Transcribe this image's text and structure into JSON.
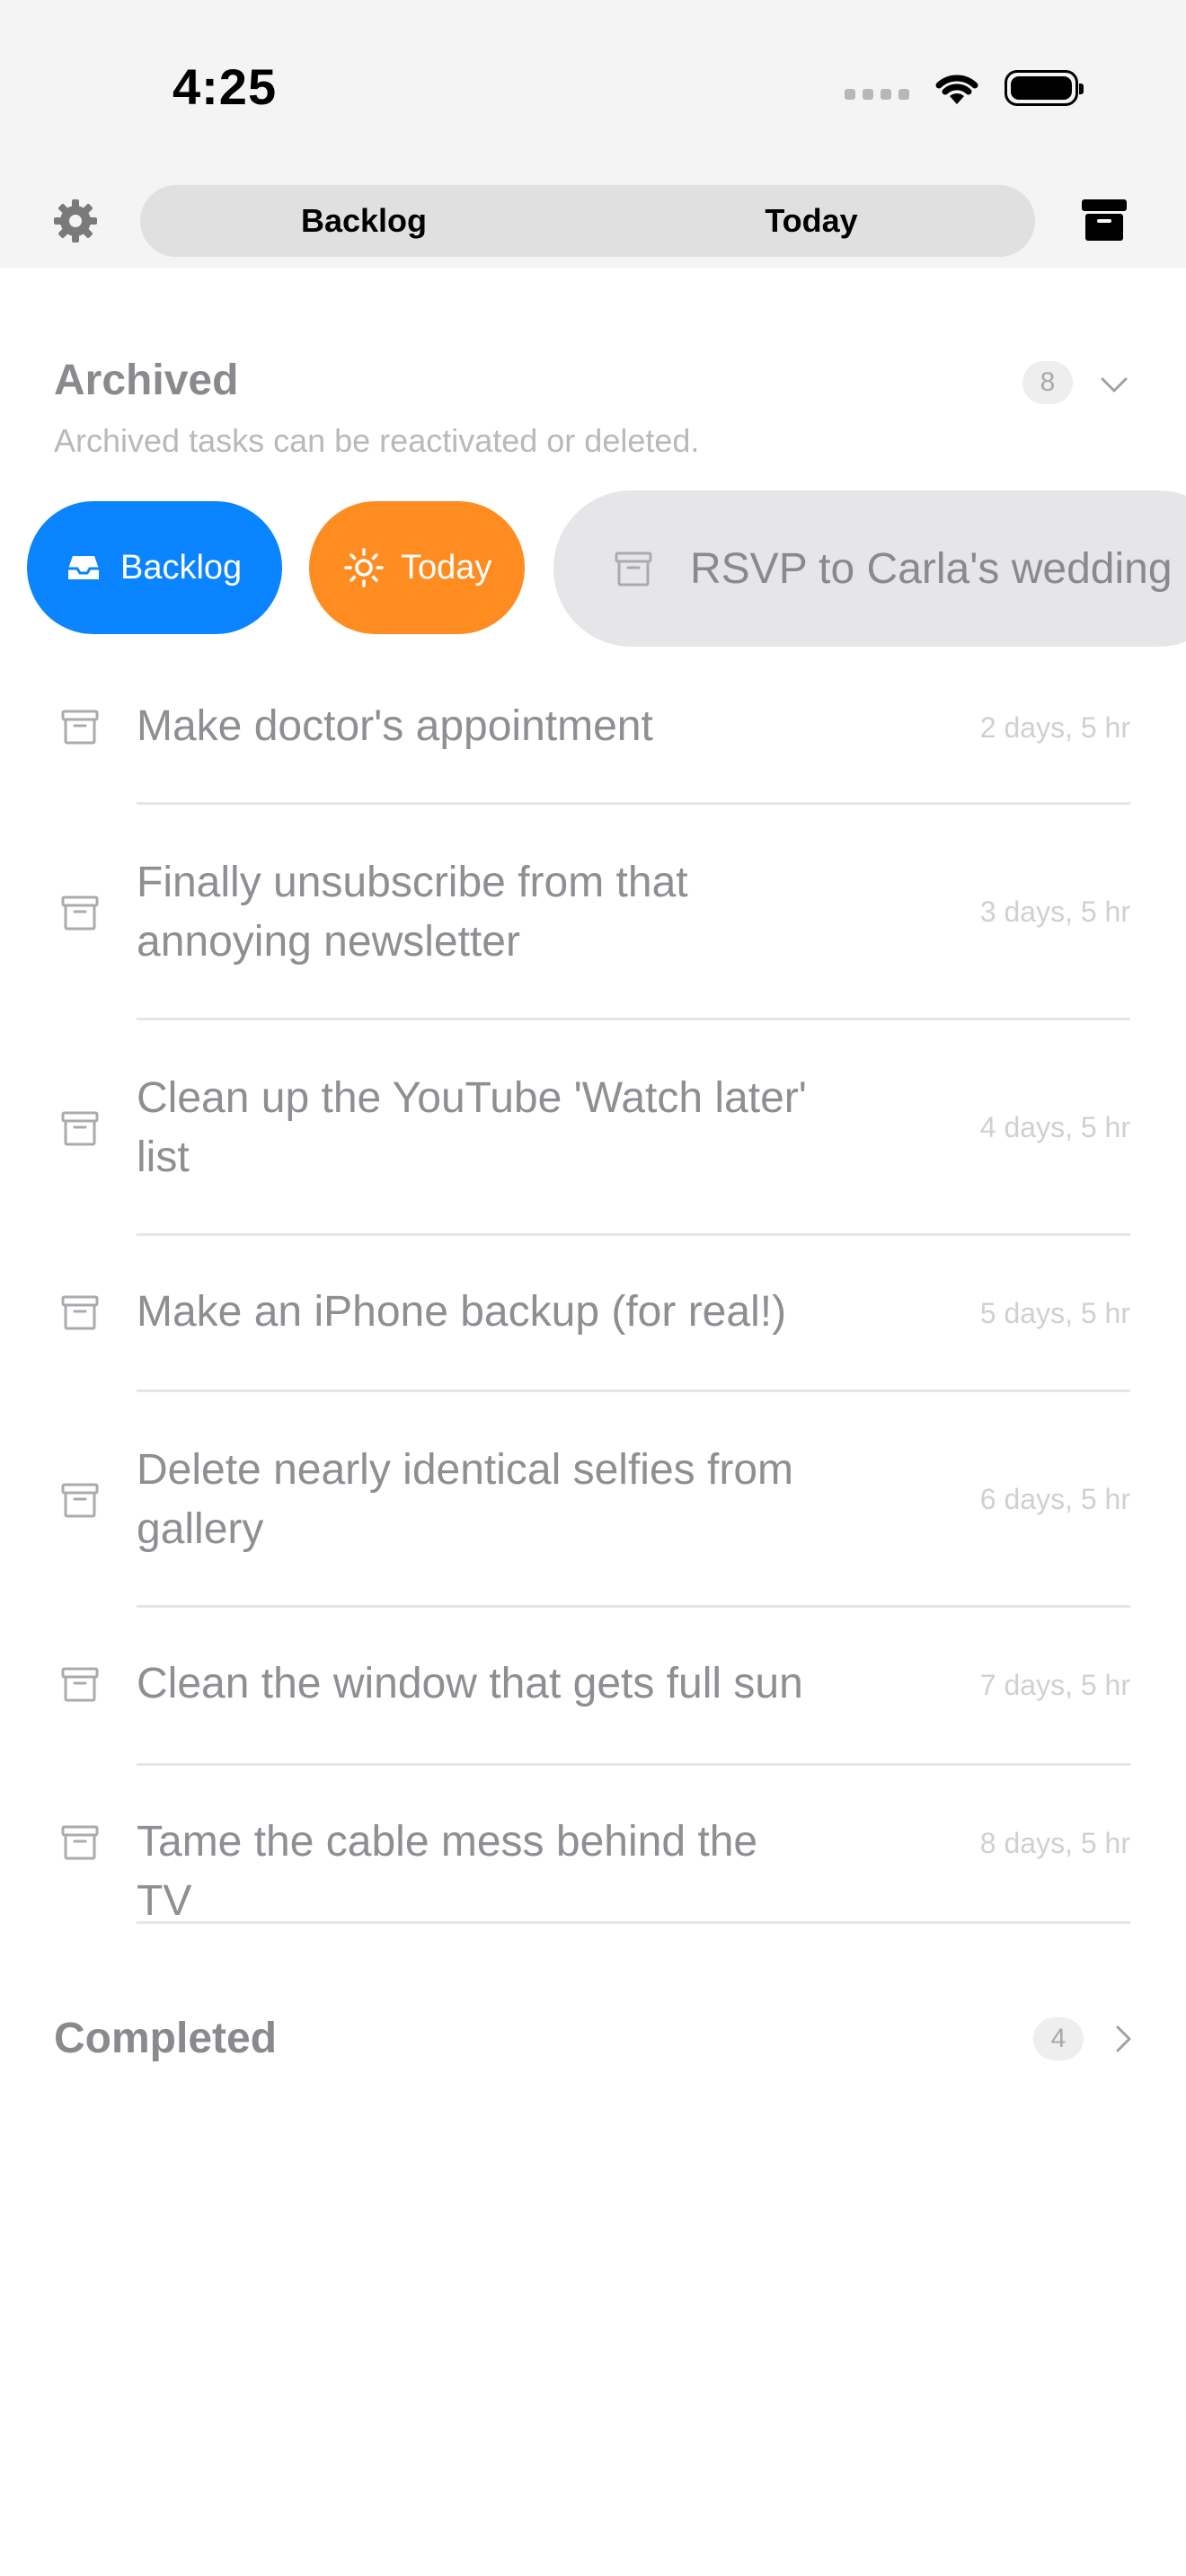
{
  "status_bar": {
    "time": "4:25"
  },
  "nav": {
    "segments": [
      {
        "label": "Backlog"
      },
      {
        "label": "Today"
      }
    ]
  },
  "archived": {
    "title": "Archived",
    "subtitle": "Archived tasks can be reactivated or deleted.",
    "count": "8",
    "swipe_actions": {
      "backlog": "Backlog",
      "today": "Today"
    },
    "swiped_item": "RSVP to Carla's wedding",
    "items": [
      {
        "text": "Make doctor's appointment",
        "age": "2 days, 5 hr"
      },
      {
        "text": "Finally unsubscribe from that annoying newsletter",
        "age": "3 days, 5 hr"
      },
      {
        "text": "Clean up the YouTube 'Watch later' list",
        "age": "4 days, 5 hr"
      },
      {
        "text": "Make an iPhone backup (for real!)",
        "age": "5 days, 5 hr"
      },
      {
        "text": "Delete nearly identical selfies from gallery",
        "age": "6 days, 5 hr"
      },
      {
        "text": "Clean the window that gets full sun",
        "age": "7 days, 5 hr"
      },
      {
        "text": "Tame the cable mess behind the TV",
        "age": "8 days, 5 hr"
      }
    ]
  },
  "completed": {
    "title": "Completed",
    "count": "4"
  },
  "colors": {
    "accent_blue": "#0a84ff",
    "accent_orange": "#ff8c21"
  }
}
